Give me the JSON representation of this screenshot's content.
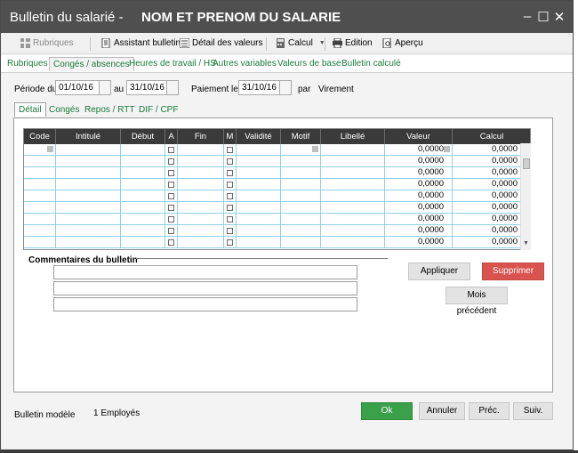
{
  "window": {
    "title_prefix": "Bulletin du salarié -",
    "title_name": "NOM ET PRENOM DU SALARIE",
    "minimize": "–",
    "maximize": "☐",
    "close": "✕"
  },
  "toolbar": {
    "rubriques": "Rubriques",
    "assistant": "Assistant bulletin",
    "detail": "Détail des valeurs",
    "calcul": "Calcul",
    "edition": "Edition",
    "apercu": "Aperçu"
  },
  "nav_tabs": [
    "Rubriques",
    "Congés / absences",
    "Heures de travail / HS",
    "Autres variables",
    "Valeurs de base",
    "Bulletin calculé"
  ],
  "period": {
    "label_from": "Période du",
    "from": "01/10/16",
    "label_to": "au",
    "to": "31/10/16",
    "label_payment": "Paiement le",
    "payment": "31/10/16",
    "label_by": "par",
    "method": "Virement"
  },
  "sub_tabs": [
    "Détail",
    "Congés",
    "Repos / RTT",
    "DIF / CPF"
  ],
  "grid": {
    "columns": [
      "Code",
      "Intitulé",
      "Début",
      "A",
      "Fin",
      "M",
      "Validité",
      "Motif",
      "Libellé",
      "Valeur",
      "Calcul"
    ],
    "rows": [
      {
        "valeur": "0,0000",
        "calcul": "0,0000"
      },
      {
        "valeur": "0,0000",
        "calcul": "0,0000"
      },
      {
        "valeur": "0,0000",
        "calcul": "0,0000"
      },
      {
        "valeur": "0,0000",
        "calcul": "0,0000"
      },
      {
        "valeur": "0,0000",
        "calcul": "0,0000"
      },
      {
        "valeur": "0,0000",
        "calcul": "0,0000"
      },
      {
        "valeur": "0,0000",
        "calcul": "0,0000"
      },
      {
        "valeur": "0,0000",
        "calcul": "0,0000"
      },
      {
        "valeur": "0,0000",
        "calcul": "0,0000"
      }
    ]
  },
  "comments": {
    "title": "Commentaires du bulletin"
  },
  "actions": {
    "appliquer": "Appliquer",
    "supprimer": "Supprimer",
    "mois_precedent": "Mois précédent"
  },
  "footer": {
    "modele": "Bulletin modèle",
    "employes": "1 Employés",
    "ok": "Ok",
    "annuler": "Annuler",
    "prec": "Préc.",
    "suiv": "Suiv."
  },
  "colors": {
    "titlebar": "#4f4f4f",
    "link_green": "#1a7a3a",
    "grid_header": "#3a3a3a",
    "ok_green": "#3aa04a",
    "delete_red": "#d9534f"
  }
}
